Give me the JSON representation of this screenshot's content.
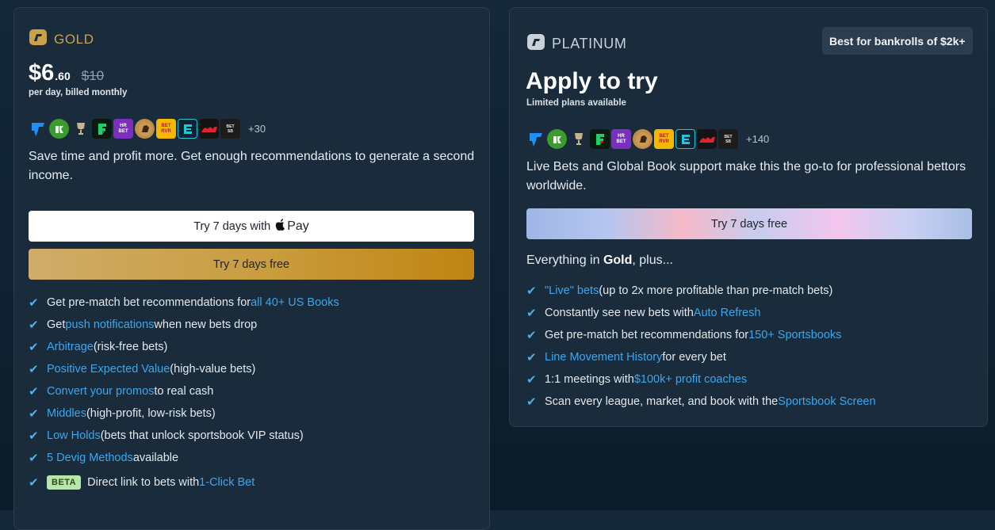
{
  "gold": {
    "brand": "GOLD",
    "price_main": "$6",
    "price_cents": ".60",
    "price_old": "$10",
    "billing": "per day, billed monthly",
    "books_more": "+30",
    "description": "Save time and profit more. Get enough recommendations to generate a second income.",
    "applepay_prefix": "Try 7 days with",
    "applepay_brand": "Pay",
    "trial_label": "Try 7 days free",
    "features": [
      {
        "pre": "Get pre-match bet recommendations for ",
        "link": "all 40+ US Books",
        "post": ""
      },
      {
        "pre": "Get ",
        "link": "push notifications",
        "post": " when new bets drop"
      },
      {
        "pre": "",
        "link": "Arbitrage",
        "post": " (risk-free bets)"
      },
      {
        "pre": "",
        "link": "Positive Expected Value",
        "post": " (high-value bets)"
      },
      {
        "pre": "",
        "link": "Convert your promos",
        "post": " to real cash"
      },
      {
        "pre": "",
        "link": "Middles",
        "post": " (high-profit, low-risk bets)"
      },
      {
        "pre": "",
        "link": "Low Holds",
        "post": " (bets that unlock sportsbook VIP status)"
      },
      {
        "pre": "",
        "link": "5 Devig Methods",
        "post": " available"
      }
    ],
    "beta_feature": {
      "badge": "BETA",
      "pre": "Direct link to bets with ",
      "link": "1-Click Bet"
    }
  },
  "platinum": {
    "brand": "PLATINUM",
    "badge": "Best for bankrolls of $2k+",
    "headline": "Apply to try",
    "sub": "Limited plans available",
    "books_more": "+140",
    "description": "Live Bets and Global Book support make this the go-to for professional bettors worldwide.",
    "trial_label": "Try 7 days free",
    "plus_pre": "Everything in ",
    "plus_bold": "Gold",
    "plus_post": ", plus...",
    "features": [
      {
        "pre": "",
        "link": "\"Live\" bets",
        "post": " (up to 2x more profitable than pre-match bets)"
      },
      {
        "pre": "Constantly see new bets with ",
        "link": "Auto Refresh",
        "post": ""
      },
      {
        "pre": "Get pre-match bet recommendations for ",
        "link": "150+ Sportsbooks",
        "post": ""
      },
      {
        "pre": "",
        "link": "Line Movement History",
        "post": " for every bet"
      },
      {
        "pre": "1:1 meetings with ",
        "link": "$100k+ profit coaches",
        "post": ""
      },
      {
        "pre": "Scan every league, market, and book with the ",
        "link": "Sportsbook Screen",
        "post": ""
      }
    ]
  },
  "icons": {
    "check": "check-icon",
    "gold_logo": "gold-logo-icon",
    "platinum_logo": "platinum-logo-icon",
    "apple": "apple-icon"
  },
  "colors": {
    "page_bg": "#0f2132",
    "card_bg": "#1a2b3c",
    "gold_accent": "#c9a24e",
    "link": "#3aa7ee",
    "check": "#4fb0ea",
    "beta_bg": "#b8e6a8"
  }
}
